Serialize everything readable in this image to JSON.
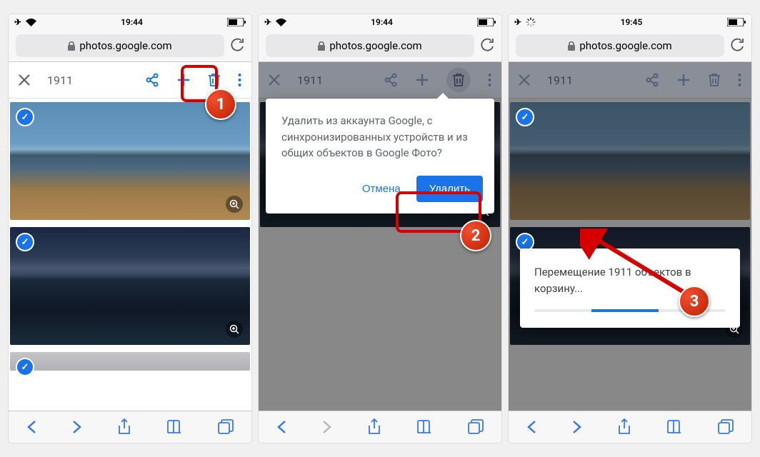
{
  "status": {
    "time1": "19:44",
    "time2": "19:44",
    "time3": "19:45"
  },
  "url": "photos.google.com",
  "toolbar": {
    "count": "1911"
  },
  "dialog": {
    "text": "Удалить из аккаунта Google, с синхронизированных устройств и из общих объектов в Google Фото?",
    "cancel": "Отмена",
    "delete": "Удалить"
  },
  "progress": {
    "text": "Перемещение 1911 объектов в корзину..."
  },
  "steps": {
    "s1": "1",
    "s2": "2",
    "s3": "3"
  }
}
